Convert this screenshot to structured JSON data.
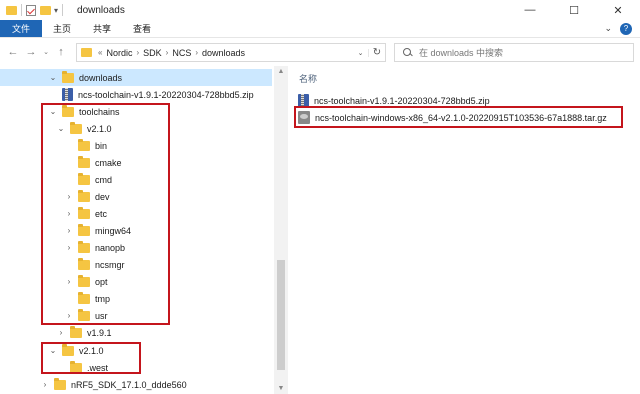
{
  "window": {
    "title": "downloads",
    "minimize_glyph": "—",
    "maximize_glyph": "☐",
    "close_glyph": "✕"
  },
  "ribbon": {
    "tabs": [
      "文件",
      "主页",
      "共享",
      "查看"
    ],
    "expand_glyph": "⌄",
    "help_glyph": "?",
    "accent_color": "#1f66b5"
  },
  "address": {
    "back_glyph": "←",
    "forward_glyph": "→",
    "recent_glyph": "⌄",
    "up_glyph": "↑",
    "overflow": "«",
    "crumbs": [
      "Nordic",
      "SDK",
      "NCS",
      "downloads"
    ],
    "separator": "›",
    "dropdown_glyph": "⌄",
    "refresh_glyph": "↻"
  },
  "search": {
    "placeholder": "在 downloads 中搜索"
  },
  "tree": {
    "items": [
      {
        "label": "downloads",
        "icon": "folder-icon",
        "expanded": true,
        "selected": true
      },
      {
        "label": "ncs-toolchain-v1.9.1-20220304-728bbd5.zip",
        "icon": "zip-icon"
      },
      {
        "label": "toolchains",
        "icon": "folder-icon",
        "expanded": true
      },
      {
        "label": "v2.1.0",
        "icon": "folder-icon",
        "expanded": true
      },
      {
        "label": "bin",
        "icon": "folder-icon"
      },
      {
        "label": "cmake",
        "icon": "folder-icon"
      },
      {
        "label": "cmd",
        "icon": "folder-icon"
      },
      {
        "label": "dev",
        "icon": "folder-icon",
        "collapsed": true
      },
      {
        "label": "etc",
        "icon": "folder-icon",
        "collapsed": true
      },
      {
        "label": "mingw64",
        "icon": "folder-icon",
        "collapsed": true
      },
      {
        "label": "nanopb",
        "icon": "folder-icon",
        "collapsed": true
      },
      {
        "label": "ncsmgr",
        "icon": "folder-icon"
      },
      {
        "label": "opt",
        "icon": "folder-icon",
        "collapsed": true
      },
      {
        "label": "tmp",
        "icon": "folder-icon"
      },
      {
        "label": "usr",
        "icon": "folder-icon",
        "collapsed": true
      },
      {
        "label": "v1.9.1",
        "icon": "folder-icon",
        "collapsed": true
      },
      {
        "label": "v2.1.0",
        "icon": "folder-icon",
        "expanded": true
      },
      {
        "label": ".west",
        "icon": "folder-icon"
      },
      {
        "label": "nRF5_SDK_17.1.0_ddde560",
        "icon": "folder-icon",
        "collapsed": true
      }
    ],
    "expanded_glyph": "⌄",
    "collapsed_glyph": "›"
  },
  "content": {
    "column_header": "名称",
    "files": [
      {
        "name": "ncs-toolchain-v1.9.1-20220304-728bbd5.zip",
        "icon": "zip-icon"
      },
      {
        "name": "ncs-toolchain-windows-x86_64-v2.1.0-20220915T103536-67a1888.tar.gz",
        "icon": "archive-icon"
      }
    ]
  },
  "scrollbar": {
    "up_glyph": "▲",
    "down_glyph": "▼"
  },
  "highlight_color": "#c4151c"
}
